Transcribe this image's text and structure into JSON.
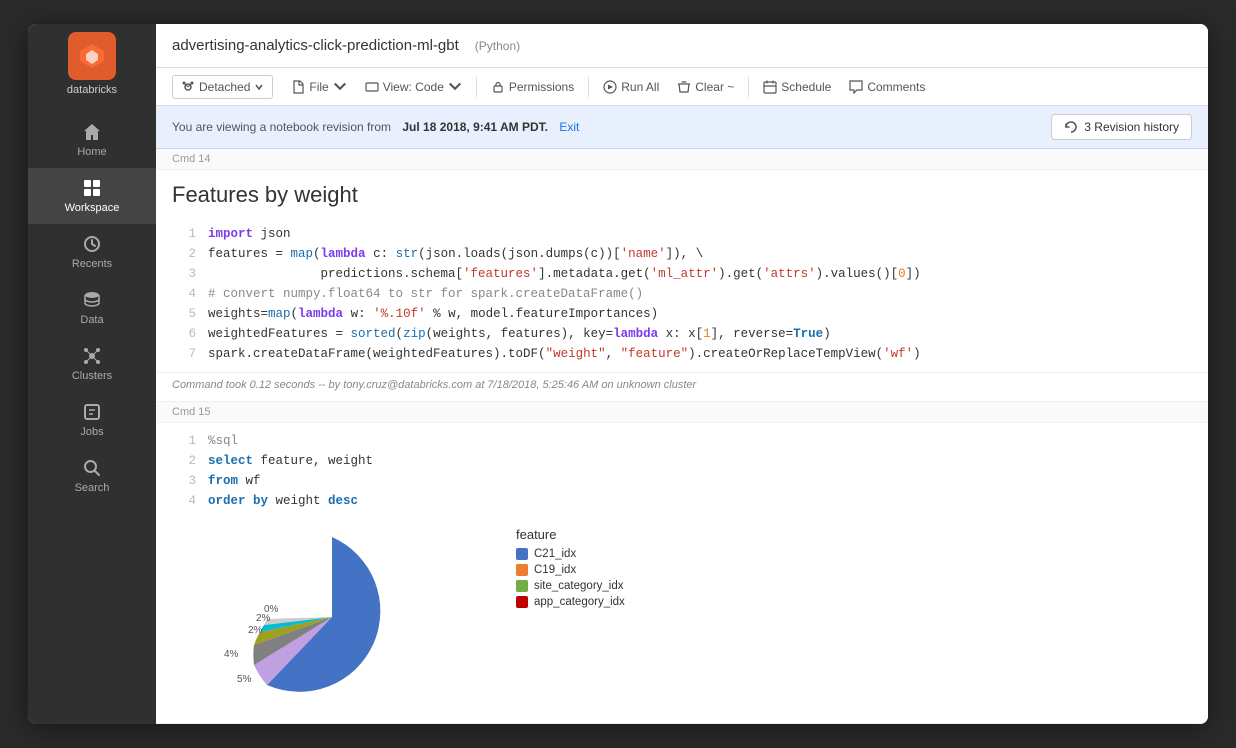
{
  "sidebar": {
    "brand": "databricks",
    "items": [
      {
        "id": "home",
        "label": "Home",
        "icon": "home-icon"
      },
      {
        "id": "workspace",
        "label": "Workspace",
        "icon": "workspace-icon",
        "active": true
      },
      {
        "id": "recents",
        "label": "Recents",
        "icon": "recents-icon"
      },
      {
        "id": "data",
        "label": "Data",
        "icon": "data-icon"
      },
      {
        "id": "clusters",
        "label": "Clusters",
        "icon": "clusters-icon"
      },
      {
        "id": "jobs",
        "label": "Jobs",
        "icon": "jobs-icon"
      },
      {
        "id": "search",
        "label": "Search",
        "icon": "search-icon"
      }
    ]
  },
  "header": {
    "notebook_title": "advertising-analytics-click-prediction-ml-gbt",
    "notebook_lang": "(Python)"
  },
  "toolbar": {
    "cluster_label": "Detached",
    "file_label": "File",
    "view_label": "View: Code",
    "permissions_label": "Permissions",
    "run_all_label": "Run All",
    "clear_label": "Clear ~",
    "schedule_label": "Schedule",
    "comments_label": "Comments"
  },
  "revision_banner": {
    "text_prefix": "You are viewing a notebook revision from",
    "date": "Jul 18 2018, 9:41 AM PDT.",
    "exit_label": "Exit",
    "revision_history_label": "3 Revision history"
  },
  "cells": {
    "cmd14": {
      "header": "Cmd 14",
      "title": "Features by weight",
      "lines": [
        {
          "num": 1,
          "content": "import json"
        },
        {
          "num": 2,
          "content": "features = map(lambda c: str(json.loads(json.dumps(c))['name']), \\"
        },
        {
          "num": 3,
          "content": "               predictions.schema['features'].metadata.get('ml_attr').get('attrs').values()[0])"
        },
        {
          "num": 4,
          "content": "# convert numpy.float64 to str for spark.createDataFrame()"
        },
        {
          "num": 5,
          "content": "weights=map(lambda w: '%.10f' % w, model.featureImportances)"
        },
        {
          "num": 6,
          "content": "weightedFeatures = sorted(zip(weights, features), key=lambda x: x[1], reverse=True)"
        },
        {
          "num": 7,
          "content": "spark.createDataFrame(weightedFeatures).toDF(\"weight\", \"feature\").createOrReplaceTempView('wf')"
        }
      ],
      "output": "Command took 0.12 seconds -- by tony.cruz@databricks.com at 7/18/2018, 5:25:46 AM on unknown cluster"
    },
    "cmd15": {
      "header": "Cmd 15",
      "lines": [
        {
          "num": 1,
          "content": "%sql"
        },
        {
          "num": 2,
          "content": "select feature, weight"
        },
        {
          "num": 3,
          "content": "from wf"
        },
        {
          "num": 4,
          "content": "order by weight desc"
        }
      ],
      "legend": {
        "title": "feature",
        "items": [
          {
            "label": "C21_idx",
            "color": "#4472C4"
          },
          {
            "label": "C19_idx",
            "color": "#ED7D31"
          },
          {
            "label": "site_category_idx",
            "color": "#70AD47"
          },
          {
            "label": "app_category_idx",
            "color": "#C00000"
          }
        ]
      },
      "pie_labels": [
        {
          "pct": "5%",
          "color": "#a6a6ff"
        },
        {
          "pct": "4%",
          "color": "#888"
        },
        {
          "pct": "2%",
          "color": "#c0c020"
        },
        {
          "pct": "2%",
          "color": "#00bcd4"
        },
        {
          "pct": "0%",
          "color": "#ccc"
        }
      ]
    }
  }
}
